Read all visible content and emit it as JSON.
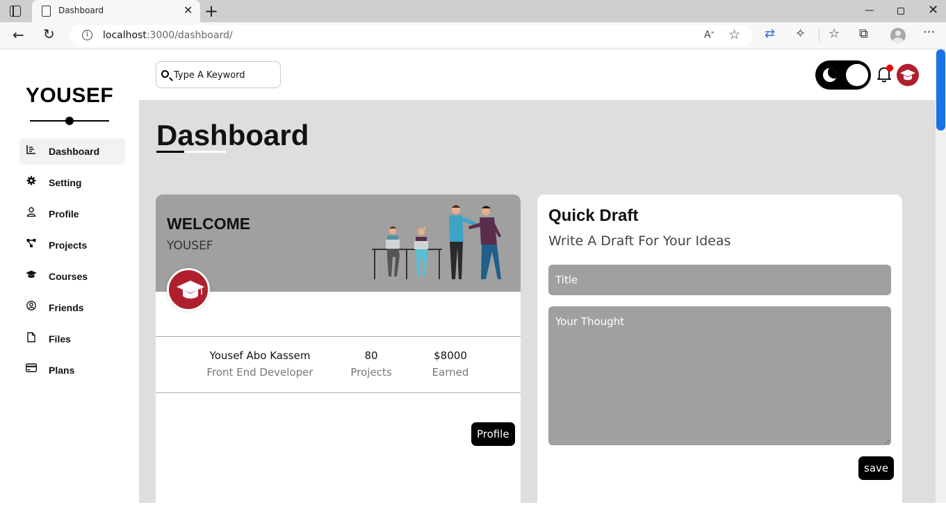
{
  "browser": {
    "tab_title": "Dashboard",
    "url_host": "localhost",
    "url_rest": ":3000/dashboard/"
  },
  "sidebar": {
    "brand": "YOUSEF",
    "items": [
      {
        "label": "Dashboard",
        "icon": "chart-icon",
        "active": true
      },
      {
        "label": "Setting",
        "icon": "gear-icon"
      },
      {
        "label": "Profile",
        "icon": "user-icon"
      },
      {
        "label": "Projects",
        "icon": "diagram-icon"
      },
      {
        "label": "Courses",
        "icon": "graduation-cap-icon"
      },
      {
        "label": "Friends",
        "icon": "user-circle-icon"
      },
      {
        "label": "Files",
        "icon": "file-icon"
      },
      {
        "label": "Plans",
        "icon": "credit-card-icon"
      }
    ]
  },
  "header": {
    "search_placeholder": "Type A Keyword"
  },
  "page": {
    "title": "Dashboard"
  },
  "welcome": {
    "title": "WELCOME",
    "name": "YOUSEF",
    "full_name": "Yousef Abo Kassem",
    "role": "Front End Developer",
    "projects_value": "80",
    "projects_label": "Projects",
    "earned_value": "$8000",
    "earned_label": "Earned",
    "profile_button": "Profile"
  },
  "draft": {
    "title": "Quick Draft",
    "subtitle": "Write A Draft For Your Ideas",
    "title_placeholder": "Title",
    "body_placeholder": "Your Thought",
    "save_button": "save"
  },
  "colors": {
    "accent_red": "#b01f2e",
    "card_header_gray": "#a0a0a0",
    "page_bg": "#dedede",
    "scrollbar_blue": "#1a73e8"
  }
}
